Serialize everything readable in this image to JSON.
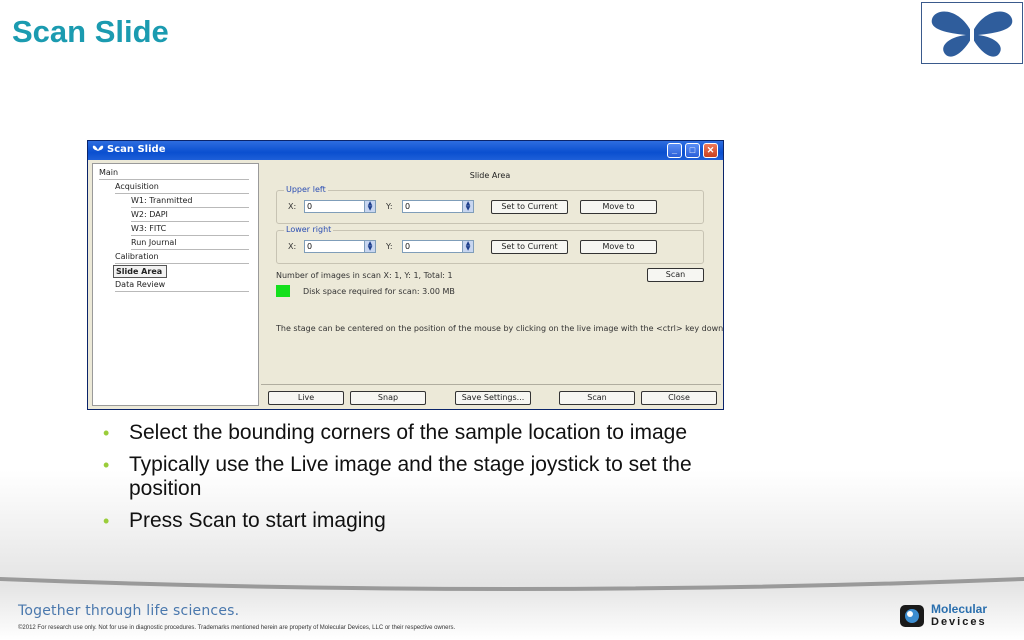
{
  "slide": {
    "title": "Scan Slide",
    "bullets": [
      "Select the bounding corners of the sample location to image",
      "Typically use the Live image and the stage joystick to set the position",
      "Press Scan to start imaging"
    ],
    "footer_tagline": "Together through life sciences.",
    "copyright": "©2012 For research use only. Not for use in diagnostic procedures. Trademarks mentioned herein are property of Molecular Devices, LLC or their respective owners.",
    "brand_line1": "Molecular",
    "brand_line2": "Devices"
  },
  "window": {
    "title": "Scan Slide",
    "controls": {
      "minimize": "_",
      "maximize": "□",
      "close": "✕"
    },
    "tree": {
      "root": "Main",
      "acquisition": "Acquisition",
      "w1": "W1: Tranmitted",
      "w2": "W2: DAPI",
      "w3": "W3: FITC",
      "run_journal": "Run Journal",
      "calibration": "Calibration",
      "slide_area": "Slide Area",
      "data_review": "Data Review"
    },
    "panel": {
      "title": "Slide Area",
      "upper_left": {
        "label": "Upper left",
        "x_label": "X:",
        "x_value": "0",
        "y_label": "Y:",
        "y_value": "0",
        "set_button": "Set to Current",
        "move_button": "Move to"
      },
      "lower_right": {
        "label": "Lower right",
        "x_label": "X:",
        "x_value": "0",
        "y_label": "Y:",
        "y_value": "0",
        "set_button": "Set to Current",
        "move_button": "Move to"
      },
      "images_info": "Number of images in scan X: 1,  Y: 1,  Total: 1",
      "scan_button": "Scan",
      "disk_space": "Disk space required for scan: 3.00 MB",
      "hint": "The stage can be centered on the position of the mouse by clicking on the live image with the <ctrl> key down"
    },
    "bottom_buttons": {
      "live": "Live",
      "snap": "Snap",
      "save_settings": "Save Settings...",
      "scan": "Scan",
      "close": "Close"
    }
  },
  "colors": {
    "title": "#1b9bb0",
    "bullet": "#9acd3a",
    "titlebar": "#0a4fd0",
    "disk_indicator": "#14e01c"
  }
}
